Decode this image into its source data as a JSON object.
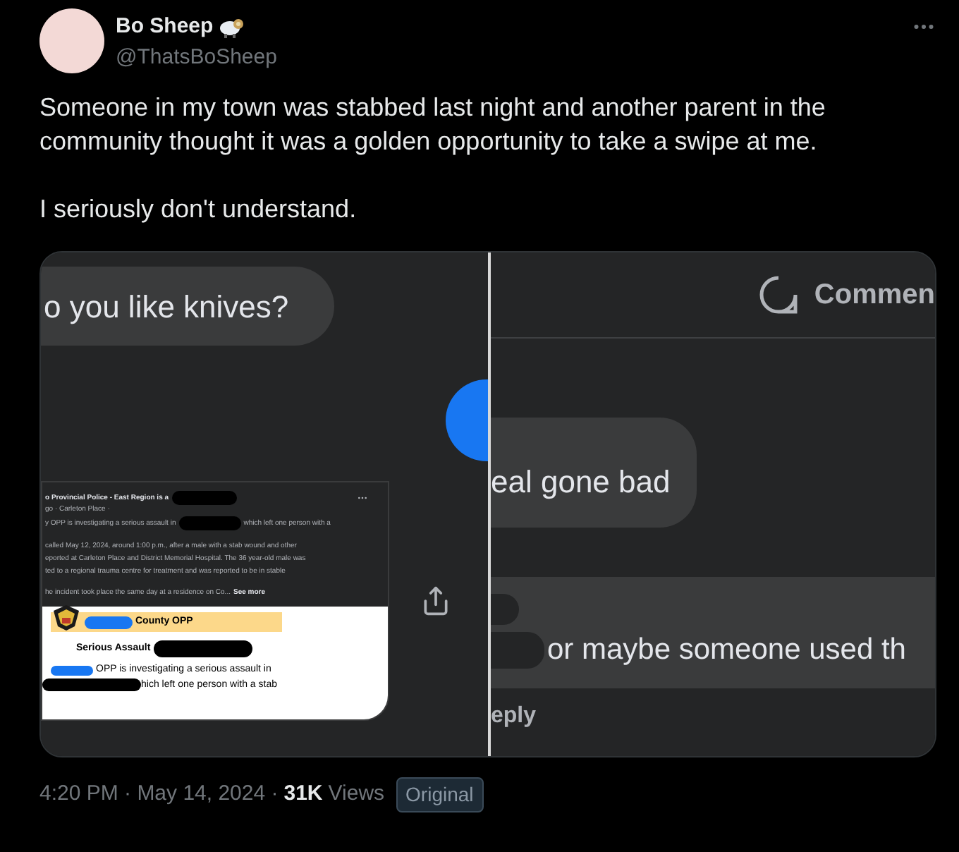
{
  "tweet": {
    "author": {
      "name": "Bo Sheep",
      "handle": "@ThatsBoSheep"
    },
    "paragraphs": [
      "Someone in my town was stabbed last night and another parent in the community thought it was a golden opportunity to take a swipe at me.",
      "I seriously don't understand."
    ],
    "footer": {
      "posted": "4:20 PM · May 14, 2024 ·",
      "views_count": "31K",
      "views_label": "Views",
      "badge": "Original"
    }
  },
  "image": {
    "left": {
      "question": "o you like knives?",
      "post": {
        "header": "o Provincial Police - East Region is a",
        "meta": "go · Carleton Place ·",
        "lines": [
          "y OPP is investigating a serious assault in",
          "which left one person with a"
        ],
        "body": [
          "called May 12, 2024, around 1:00 p.m., after a male with a stab wound and other",
          "eported at Carleton Place and District Memorial Hospital. The 36 year-old male was",
          "ted to a regional trauma centre for treatment and was reported to be in stable"
        ],
        "last_line": "he incident took place the same day at a residence on Co...",
        "see_more": "See more",
        "banner": "County OPP",
        "headline": "Serious Assault",
        "release": [
          "OPP is investigating a serious assault in",
          "hich left one person with a stab"
        ]
      }
    },
    "right": {
      "comment_label": "Commen",
      "bubble": "eal gone bad",
      "reply_text": "or maybe someone used th",
      "reply_action": "eply"
    }
  }
}
